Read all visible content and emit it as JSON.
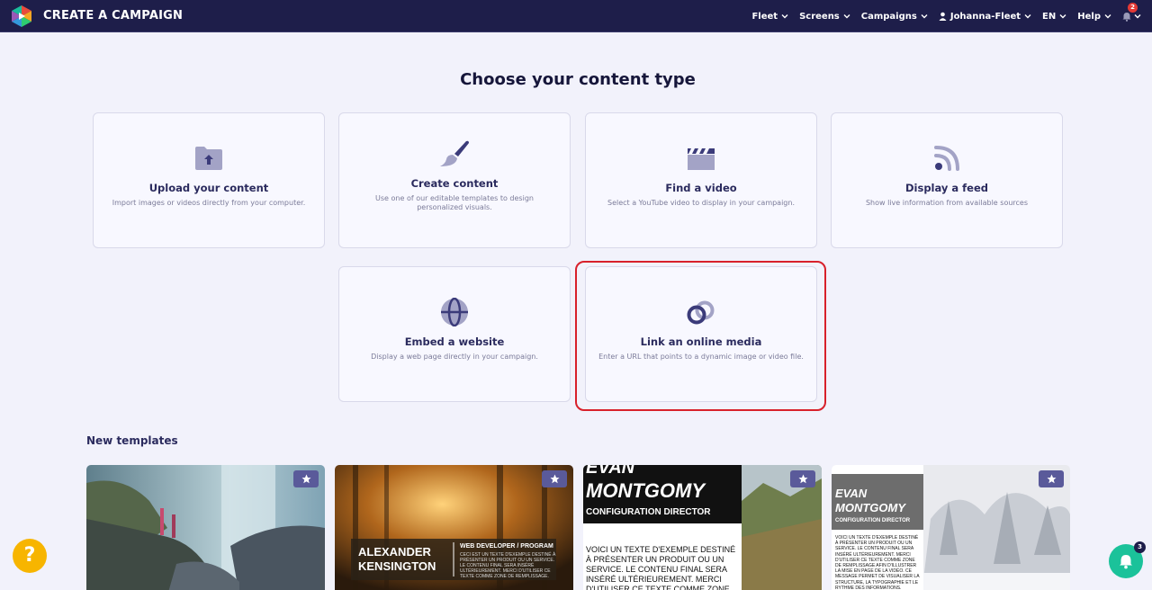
{
  "app": {
    "title": "CREATE A CAMPAIGN"
  },
  "nav": {
    "items": [
      {
        "label": "Fleet"
      },
      {
        "label": "Screens"
      },
      {
        "label": "Campaigns"
      }
    ],
    "user": "Johanna-Fleet",
    "language": "EN",
    "help": "Help",
    "bell_count": "2"
  },
  "main": {
    "heading": "Choose your content type",
    "cards": [
      {
        "title": "Upload your content",
        "desc": "Import images or videos directly from your computer.",
        "icon": "upload-folder-icon"
      },
      {
        "title": "Create content",
        "desc": "Use one of our editable templates to design personalized visuals.",
        "icon": "brush-icon"
      },
      {
        "title": "Find a video",
        "desc": "Select a YouTube video to display in your campaign.",
        "icon": "clapperboard-icon"
      },
      {
        "title": "Display a feed",
        "desc": "Show live information from available sources",
        "icon": "rss-icon"
      },
      {
        "title": "Embed a website",
        "desc": "Display a web page directly in your campaign.",
        "icon": "globe-icon"
      },
      {
        "title": "Link an online media",
        "desc": "Enter a URL that points to a dynamic image or video file.",
        "icon": "link-icon"
      }
    ],
    "new_templates_label": "New templates",
    "templates": [
      {
        "name": "waterfall"
      },
      {
        "name": "Alexander Kensington",
        "line1": "ALEXANDER",
        "line2": "KENSINGTON",
        "role": "WEB DEVELOPER / PROGRAM",
        "text": "CECI EST UN TEXTE D'EXEMPLE DESTINÉ À PRÉSENTER UN PRODUIT OU UN SERVICE. LE CONTENU FINAL SERA INSÉRÉ ULTÉRIEUREMENT. MERCI D'UTILISER CE TEXTE COMME ZONE DE REMPLISSAGE."
      },
      {
        "name": "Evan Montgomy",
        "line1": "EVAN",
        "line2": "MONTGOMY",
        "role": "CONFIGURATION DIRECTOR",
        "text": "VOICI UN TEXTE D'EXEMPLE DESTINÉ À PRÉSENTER UN PRODUIT OU UN SERVICE. LE CONTENU FINAL SERA INSÉRÉ ULTÉRIEUREMENT. MERCI D'UTILISER CE TEXTE COMME ZONE DE REMPLISSAGE AFIN D'ILLUSTRER"
      },
      {
        "name": "Evan Montgomy winter",
        "line1": "EVAN",
        "line2": "MONTGOMY",
        "role": "CONFIGURATION DIRECTOR",
        "text": "VOICI UN TEXTE D'EXEMPLE DESTINÉ À PRÉSENTER UN PRODUIT OU UN SERVICE. LE CONTENU FINAL SERA INSÉRÉ ULTÉRIEUREMENT. MERCI D'UTILISER CE TEXTE COMME ZONE DE REMPLISSAGE AFIN D'ILLUSTRER LA MISE EN PAGE DE LA VIDÉO. CE MESSAGE PERMET DE VISUALISER LA STRUCTURE, LA TYPOGRAPHIE ET LE RYTHME DES INFORMATIONS."
      }
    ]
  },
  "fab": {
    "help": "?",
    "notif_count": "3"
  },
  "colors": {
    "topbar": "#1e1e4a",
    "accent": "#5a5a9a",
    "highlight": "#d8212b",
    "help": "#f7b500",
    "notif": "#1bc29a"
  }
}
